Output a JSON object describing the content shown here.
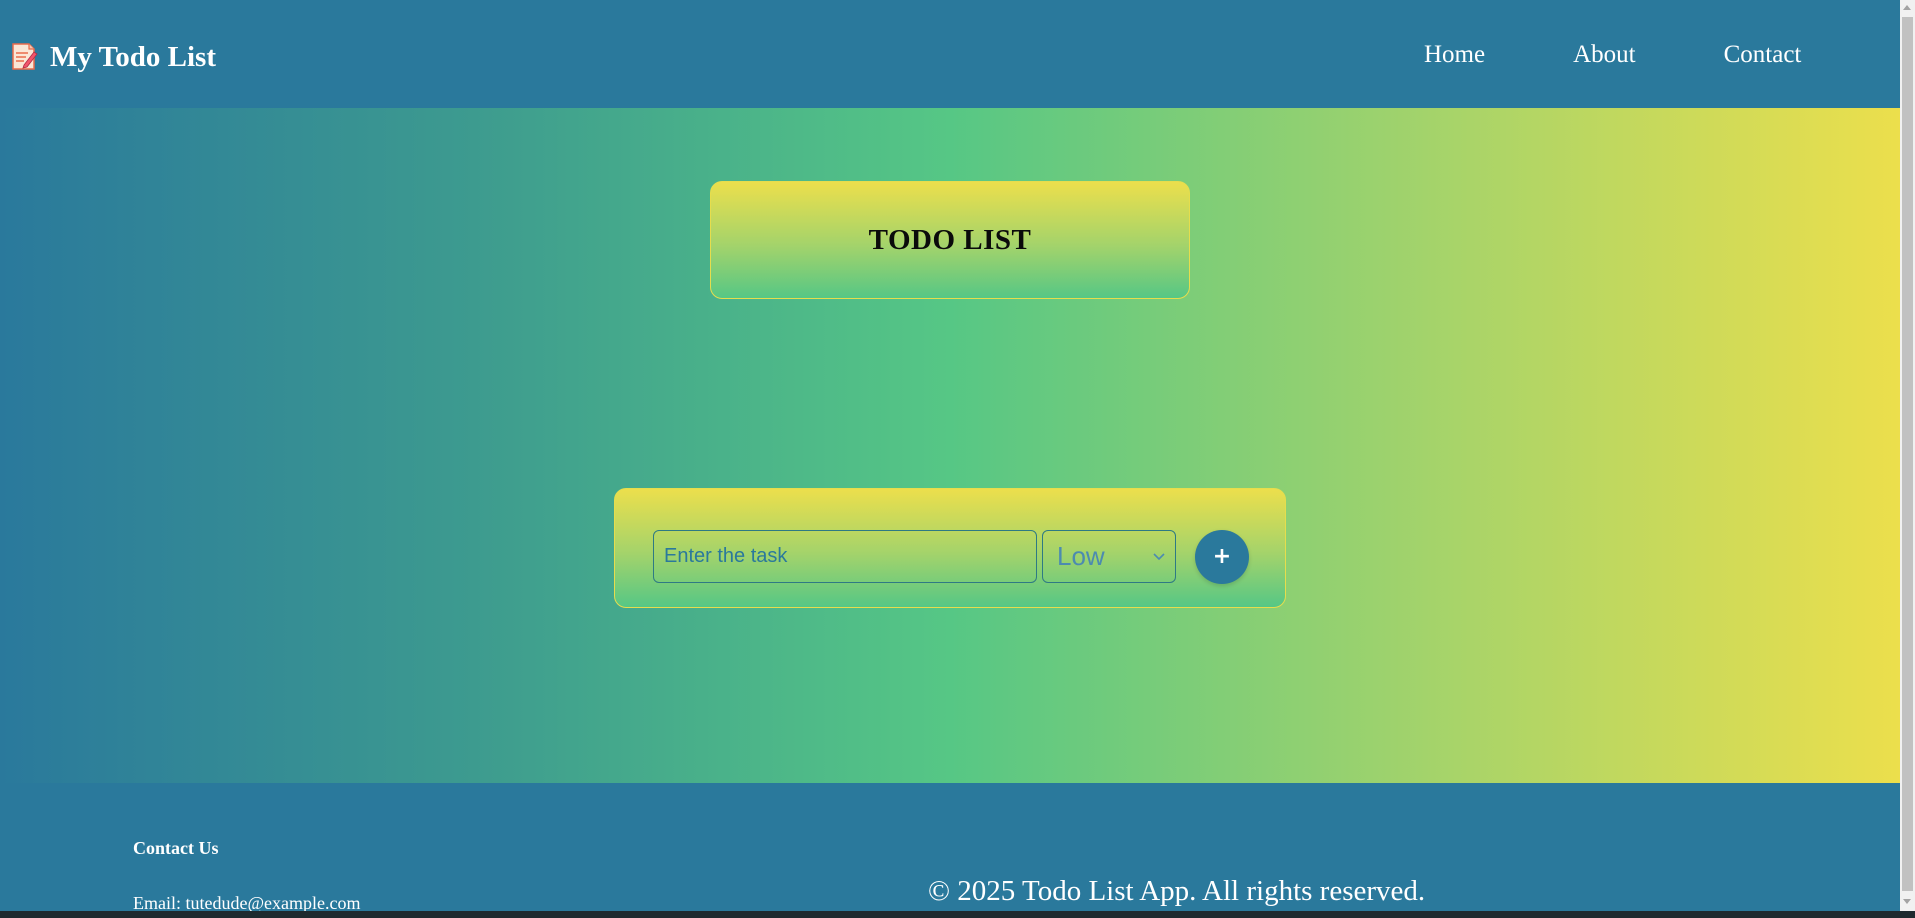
{
  "header": {
    "brand_icon": "memo-pencil-icon",
    "brand_title": "My Todo List",
    "nav": {
      "home": "Home",
      "about": "About",
      "contact": "Contact"
    }
  },
  "main": {
    "title": "TODO LIST",
    "form": {
      "task_placeholder": "Enter the task",
      "priority_selected": "Low",
      "add_label": "+"
    }
  },
  "footer": {
    "heading": "Contact Us",
    "email": "Email: tutedude@example.com",
    "copyright": "© 2025 Todo List App. All rights reserved."
  },
  "colors": {
    "header_bg": "#2a799c",
    "gradient_start": "#2a799c",
    "gradient_mid": "#56c785",
    "gradient_end": "#ecdf4c",
    "card_border": "#e6dd4d",
    "add_button_bg": "#2a799c"
  }
}
